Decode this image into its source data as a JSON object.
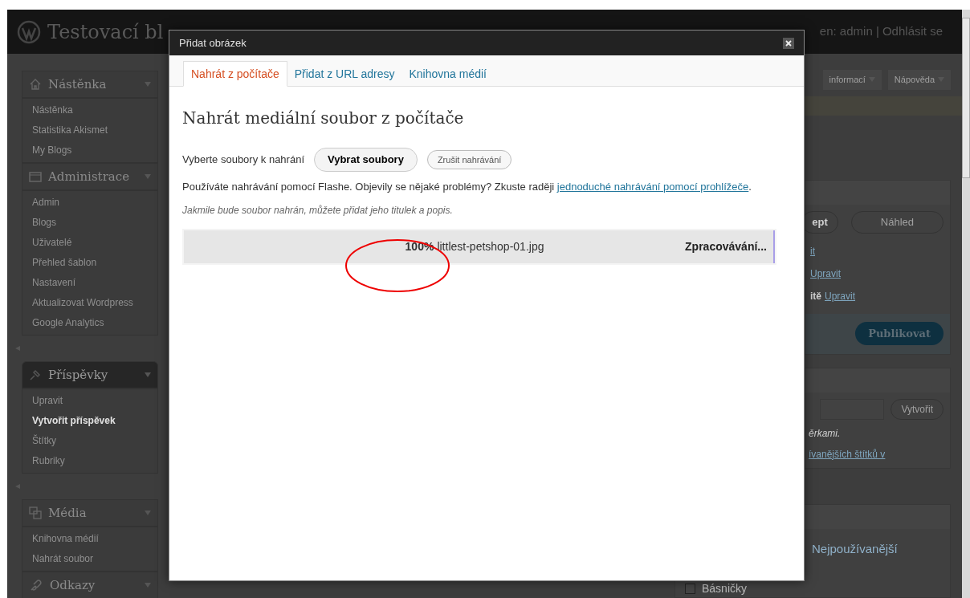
{
  "header": {
    "site_title": "Testovací bl",
    "user_text": "en: admin | Odhlásit se"
  },
  "top_tabs": [
    "informací",
    "Nápověda"
  ],
  "sidebar": {
    "groups": [
      {
        "title": "Nástěnka",
        "kind": "home",
        "active": false,
        "separator_after": false,
        "items": [
          {
            "label": "Nástěnka",
            "current": false
          },
          {
            "label": "Statistika Akismet",
            "current": false
          },
          {
            "label": "My Blogs",
            "current": false
          }
        ]
      },
      {
        "title": "Administrace",
        "kind": "folder",
        "active": false,
        "separator_after": true,
        "items": [
          {
            "label": "Admin",
            "current": false
          },
          {
            "label": "Blogs",
            "current": false
          },
          {
            "label": "Uživatelé",
            "current": false
          },
          {
            "label": "Přehled šablon",
            "current": false
          },
          {
            "label": "Nastavení",
            "current": false
          },
          {
            "label": "Aktualizovat Wordpress",
            "current": false
          },
          {
            "label": "Google Analytics",
            "current": false
          }
        ]
      },
      {
        "title": "Příspěvky",
        "kind": "pin",
        "active": true,
        "separator_after": true,
        "items": [
          {
            "label": "Upravit",
            "current": false
          },
          {
            "label": "Vytvořit příspěvek",
            "current": true
          },
          {
            "label": "Štítky",
            "current": false
          },
          {
            "label": "Rubriky",
            "current": false
          }
        ]
      },
      {
        "title": "Média",
        "kind": "media",
        "active": false,
        "separator_after": false,
        "items": [
          {
            "label": "Knihovna médií",
            "current": false
          },
          {
            "label": "Nahrát soubor",
            "current": false
          }
        ]
      },
      {
        "title": "Odkazy",
        "kind": "link",
        "active": false
      }
    ]
  },
  "right_panel": {
    "draft_button": "ept",
    "preview_button": "Náhled",
    "status_links": [
      {
        "link": "it"
      },
      {
        "link": "Upravit"
      },
      {
        "prefix": "itě",
        "link": "Upravit"
      }
    ],
    "publish_button": "Publikovat",
    "tag_button": "Vytvořit",
    "tag_hint": "ěrkami.",
    "tag_link": "ívanějších štítků v",
    "category_tab": "Nejpoužívanější",
    "category": {
      "label": "Básničky",
      "checked": false
    }
  },
  "modal": {
    "title": "Přidat obrázek",
    "tabs": [
      {
        "label": "Nahrát z počítače",
        "selected": true
      },
      {
        "label": "Přidat z URL adresy",
        "selected": false
      },
      {
        "label": "Knihovna médií",
        "selected": false
      }
    ],
    "heading": "Nahrát mediální soubor z počítače",
    "select_label": "Vyberte soubory k nahrání",
    "select_button": "Vybrat soubory",
    "cancel_button": "Zrušit nahrávání",
    "flash_note": "Používáte nahrávání pomocí Flashe. Objevily se nějaké problémy? Zkuste raději",
    "flash_link": "jednoduché nahrávání pomocí prohlížeče",
    "flash_end": ".",
    "hint": "Jakmile bude soubor nahrán, můžete přidat jeho titulek a popis.",
    "upload": {
      "percent": "100%",
      "filename": "littlest-petshop-01.jpg",
      "status": "Zpracovávání...",
      "level": 1
    }
  }
}
